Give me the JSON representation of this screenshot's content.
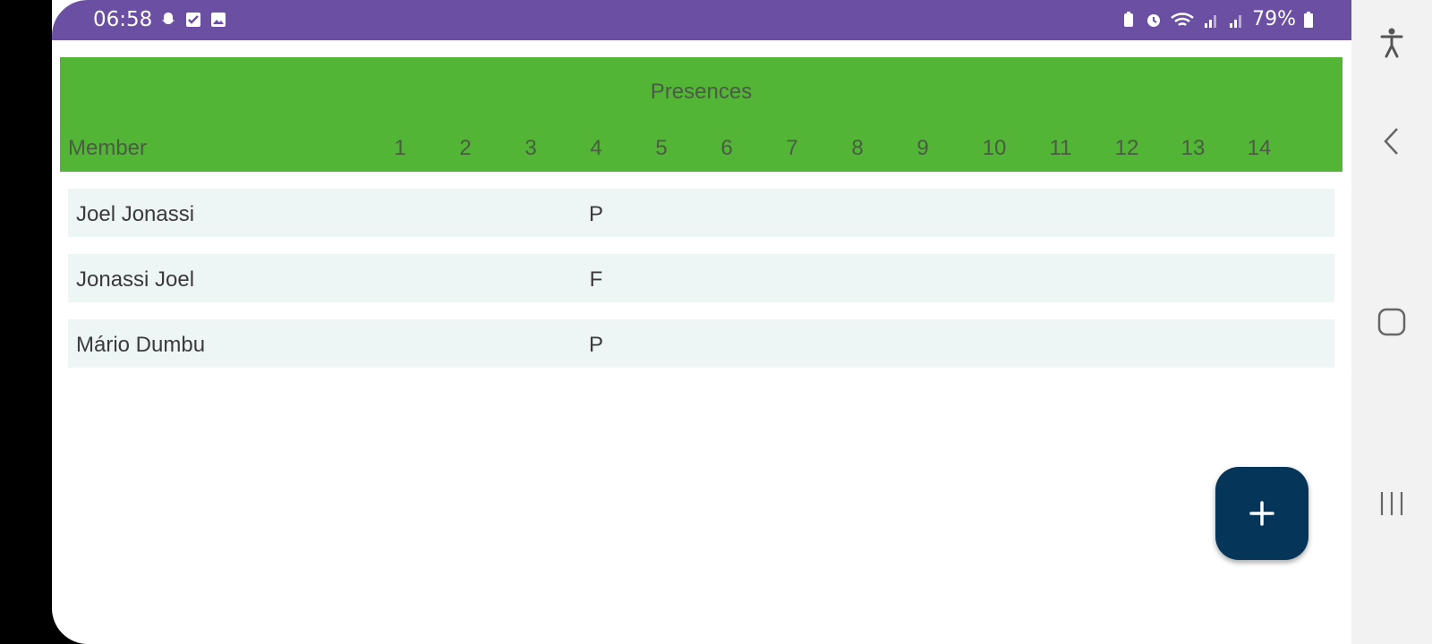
{
  "status_bar": {
    "time": "06:58",
    "battery": "79%",
    "left_icons": [
      "snapchat-icon",
      "checkbox-icon",
      "image-icon"
    ],
    "right_icons": [
      "battery-saver-icon",
      "alarm-icon",
      "wifi-icon",
      "signal-icon",
      "signal-icon",
      "battery-icon"
    ]
  },
  "table": {
    "title": "Presences",
    "member_header": "Member",
    "columns": [
      "1",
      "2",
      "3",
      "4",
      "5",
      "6",
      "7",
      "8",
      "9",
      "10",
      "11",
      "12",
      "13",
      "14"
    ],
    "rows": [
      {
        "name": "Joel Jonassi",
        "mark": "P"
      },
      {
        "name": "Jonassi Joel",
        "mark": "F"
      },
      {
        "name": "Mário Dumbu",
        "mark": "P"
      }
    ]
  },
  "fab": {
    "icon": "plus-icon"
  },
  "nav_bar": {
    "buttons": [
      "accessibility-icon",
      "back-icon",
      "home-icon",
      "recents-icon"
    ]
  },
  "colors": {
    "status_bar": "#6a4fa2",
    "header": "#53b535",
    "row": "#eef6f5",
    "fab": "#05365a"
  }
}
